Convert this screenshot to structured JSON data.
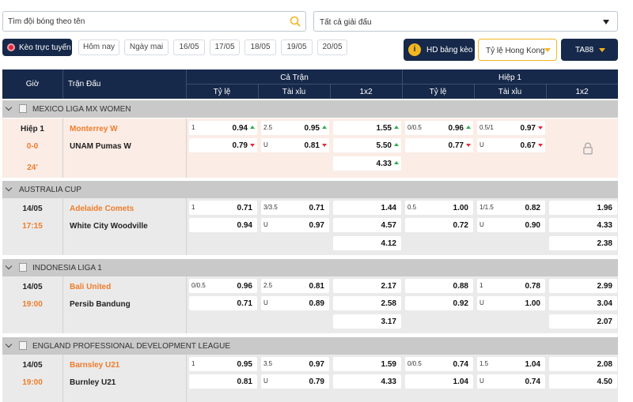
{
  "search": {
    "placeholder": "Tìm đội bóng theo tên"
  },
  "league_select": {
    "value": "Tất cả giải đấu"
  },
  "filters": {
    "live_label": "Kèo trực tuyến",
    "dates": [
      "Hôm nay",
      "Ngày mai",
      "16/05",
      "17/05",
      "18/05",
      "19/05",
      "20/05"
    ],
    "hd_label": "HD bảng kèo",
    "odds_type": "Tỷ lệ Hong Kong",
    "bookmaker": "TA88"
  },
  "table_header": {
    "time": "Giờ",
    "match": "Trận Đấu",
    "full_match": "Cả Trận",
    "half1": "Hiệp 1",
    "handicap": "Tỷ lệ",
    "over_under": "Tài xỉu",
    "x12": "1x2"
  },
  "leagues": [
    {
      "name": "MEXICO LIGA MX WOMEN",
      "match": {
        "time1": "Hiệp 1",
        "time2": "0-0",
        "time3": "24'",
        "home": "Monterrey W",
        "away": "UNAM Pumas W",
        "ft_hdp": [
          {
            "h": "1",
            "v": "0.94",
            "a": "up"
          },
          {
            "h": "",
            "v": "0.79",
            "a": "dn"
          }
        ],
        "ft_ou": [
          {
            "h": "2.5",
            "v": "0.95",
            "a": "up"
          },
          {
            "h": "U",
            "v": "0.81",
            "a": "dn"
          }
        ],
        "ft_1x2": [
          {
            "v": "1.55",
            "a": "up"
          },
          {
            "v": "5.50",
            "a": "up"
          },
          {
            "v": "4.33",
            "a": "up"
          }
        ],
        "h1_hdp": [
          {
            "h": "0/0.5",
            "v": "0.96",
            "a": "up"
          },
          {
            "h": "",
            "v": "0.77",
            "a": "dn"
          }
        ],
        "h1_ou": [
          {
            "h": "0.5/1",
            "v": "0.97",
            "a": "dn"
          },
          {
            "h": "U",
            "v": "0.67",
            "a": "dn"
          }
        ],
        "h1_1x2": "locked"
      }
    },
    {
      "name": "AUSTRALIA CUP",
      "match": {
        "time1": "14/05",
        "time2": "17:15",
        "home": "Adelaide Comets",
        "away": "White City Woodville",
        "ft_hdp": [
          {
            "h": "1",
            "v": "0.71"
          },
          {
            "h": "",
            "v": "0.94"
          }
        ],
        "ft_ou": [
          {
            "h": "3/3.5",
            "v": "0.71"
          },
          {
            "h": "U",
            "v": "0.97"
          }
        ],
        "ft_1x2": [
          {
            "v": "1.44"
          },
          {
            "v": "4.57"
          },
          {
            "v": "4.12"
          }
        ],
        "h1_hdp": [
          {
            "h": "0.5",
            "v": "1.00"
          },
          {
            "h": "",
            "v": "0.72"
          }
        ],
        "h1_ou": [
          {
            "h": "1/1.5",
            "v": "0.82"
          },
          {
            "h": "U",
            "v": "0.90"
          }
        ],
        "h1_1x2": [
          {
            "v": "1.96"
          },
          {
            "v": "4.33"
          },
          {
            "v": "2.38"
          }
        ]
      }
    },
    {
      "name": "INDONESIA LIGA 1",
      "match": {
        "time1": "14/05",
        "time2": "19:00",
        "home": "Bali United",
        "away": "Persib Bandung",
        "ft_hdp": [
          {
            "h": "0/0.5",
            "v": "0.96"
          },
          {
            "h": "",
            "v": "0.71"
          }
        ],
        "ft_ou": [
          {
            "h": "2.5",
            "v": "0.81"
          },
          {
            "h": "U",
            "v": "0.89"
          }
        ],
        "ft_1x2": [
          {
            "v": "2.17"
          },
          {
            "v": "2.58"
          },
          {
            "v": "3.17"
          }
        ],
        "h1_hdp": [
          {
            "h": "",
            "v": "0.88"
          },
          {
            "h": "",
            "v": "0.92"
          }
        ],
        "h1_ou": [
          {
            "h": "1",
            "v": "0.78"
          },
          {
            "h": "U",
            "v": "1.00"
          }
        ],
        "h1_1x2": [
          {
            "v": "2.99"
          },
          {
            "v": "3.04"
          },
          {
            "v": "2.07"
          }
        ]
      }
    },
    {
      "name": "ENGLAND PROFESSIONAL DEVELOPMENT LEAGUE",
      "match": {
        "time1": "14/05",
        "time2": "19:00",
        "home": "Barnsley U21",
        "away": "Burnley U21",
        "ft_hdp": [
          {
            "h": "1",
            "v": "0.95"
          },
          {
            "h": "",
            "v": "0.81"
          }
        ],
        "ft_ou": [
          {
            "h": "3.5",
            "v": "0.97"
          },
          {
            "h": "U",
            "v": "0.79"
          }
        ],
        "ft_1x2": [
          {
            "v": "1.59"
          },
          {
            "v": "4.33"
          }
        ],
        "h1_hdp": [
          {
            "h": "0/0.5",
            "v": "0.74"
          },
          {
            "h": "",
            "v": "1.04"
          }
        ],
        "h1_ou": [
          {
            "h": "1.5",
            "v": "1.04"
          },
          {
            "h": "U",
            "v": "0.74"
          }
        ],
        "h1_1x2": [
          {
            "v": "2.08"
          },
          {
            "v": "4.50"
          }
        ]
      }
    }
  ],
  "colors": {
    "navy": "#17294a",
    "accent_orange": "#f07c2a",
    "gold": "#f3b61f",
    "up": "#2faa4c",
    "down": "#e0283a"
  }
}
